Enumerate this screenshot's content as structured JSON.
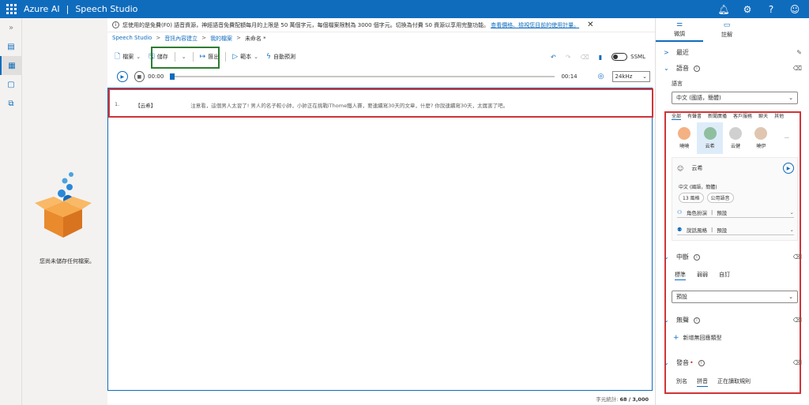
{
  "app": {
    "product": "Azure AI",
    "title": "Speech Studio"
  },
  "banner": {
    "text": "您使用的是免費(F0) 語音資源，神經語音免費配額每月的上限是 50 萬個字元，每個檔案限制為 3000 個字元。切換為付費 S0 資源以享用完整功能。",
    "link": "查看價格、檢視您目前的使用計量。",
    "close": "✕"
  },
  "breadcrumb": [
    "Speech Studio",
    "音訊內容建立",
    "我的檔案",
    "未命名 *"
  ],
  "toolbar": {
    "file": "檔案",
    "save": "儲存",
    "export": "匯出",
    "template": "範本",
    "auto_predict": "自動預測",
    "ssml": "SSML"
  },
  "player": {
    "time_start": "00:00",
    "time_end": "00:14",
    "sample_rate": "24kHz",
    "progress": 0.0
  },
  "left_panel": {
    "empty_text": "您尚未儲存任何檔案。"
  },
  "editor": {
    "line_number": "1.",
    "voice_tag": "【云希】",
    "text": "注意看，這個男人太習了! 男人的名子較小帥，小帥正在挑戰iThome鐵人賽，要連續寫30天的文章，什麼? 你說連續寫30天，太厲害了吧。"
  },
  "char_count": {
    "label": "字元統計:",
    "value": "68 / 3,000"
  },
  "right_panel": {
    "tabs": [
      "微調",
      "註解"
    ],
    "recent": "最近",
    "voice_section": "語音",
    "language_label": "語言",
    "language_value": "中文 (國語，簡體)",
    "voice_tabs": [
      "全部",
      "有聲書",
      "新聞廣播",
      "客戶服務",
      "聊天",
      "其他"
    ],
    "voices": [
      "曉曉",
      "云希",
      "云健",
      "曉伊"
    ],
    "selected_voice": {
      "name": "云希",
      "language": "中文 (國語，簡體)",
      "styles": "13 風格",
      "public": "公用語音",
      "role_label": "角色扮演",
      "role_value": "預設",
      "speak_label": "說話風格",
      "speak_value": "預設"
    },
    "break_section": "中斷",
    "break_tabs": [
      "標準",
      "弱弱",
      "自訂"
    ],
    "break_value": "預設",
    "silence_section": "無聲",
    "add_silence": "新增無回應類型",
    "pronounce_section": "發音",
    "pronounce_tabs": [
      "別名",
      "拼音",
      "正在讀取規則"
    ]
  }
}
